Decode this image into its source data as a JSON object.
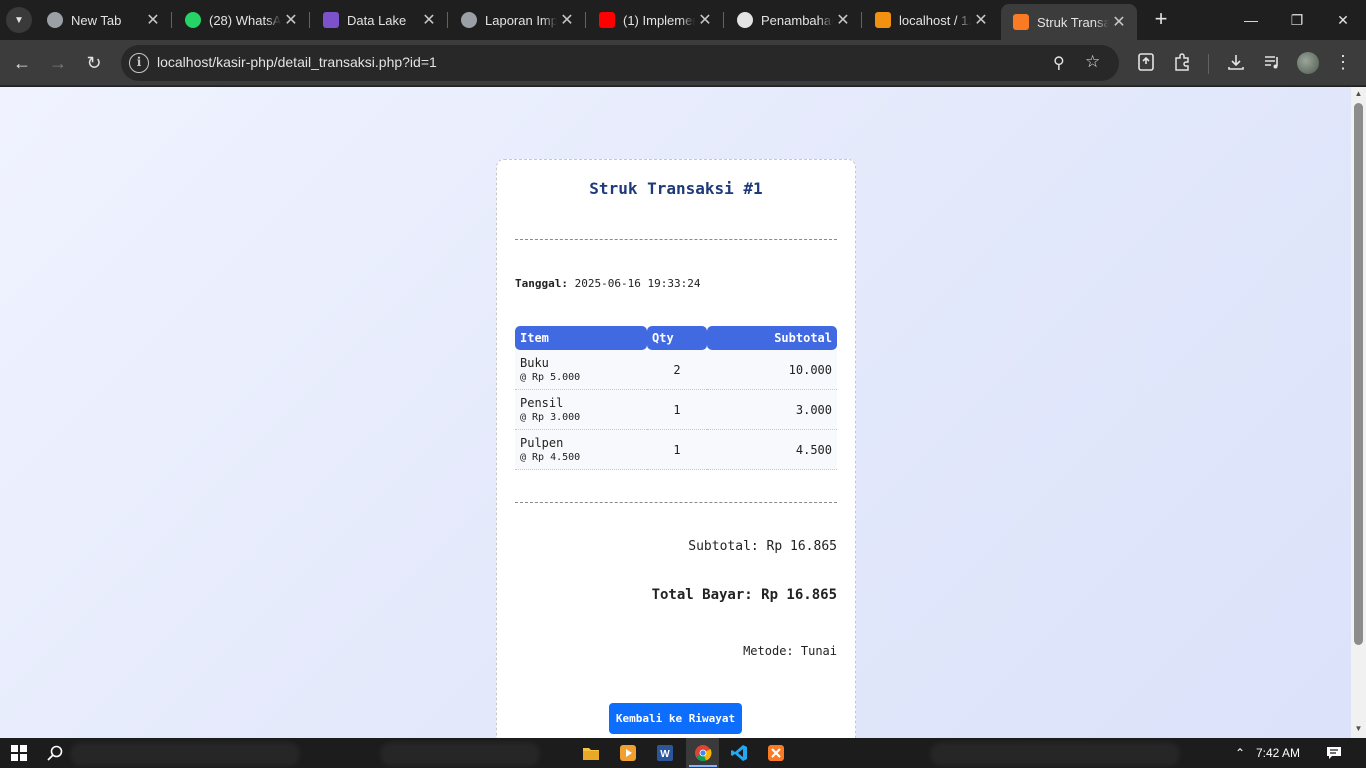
{
  "browser": {
    "tabs": [
      {
        "title": "New Tab",
        "icon": "chrome-icon",
        "color": "#9aa0a6"
      },
      {
        "title": "(28) WhatsApp",
        "icon": "whatsapp-icon",
        "color": "#25d366"
      },
      {
        "title": "Data Lake",
        "icon": "document-icon",
        "color": "#7b52c9"
      },
      {
        "title": "Laporan Implementasi",
        "icon": "globe-icon",
        "color": "#9aa0a6"
      },
      {
        "title": "(1) Implementasi",
        "icon": "youtube-icon",
        "color": "#ff0000"
      },
      {
        "title": "Penambahan",
        "icon": "openai-icon",
        "color": "#e3e3e3"
      },
      {
        "title": "localhost / 127.0.0.1",
        "icon": "phpmyadmin-icon",
        "color": "#f29111"
      },
      {
        "title": "Struk Transaksi",
        "icon": "xampp-icon",
        "color": "#fb7a24"
      }
    ],
    "active_tab_index": 7,
    "url": "localhost/kasir-php/detail_transaksi.php?id=1"
  },
  "receipt": {
    "title": "Struk Transaksi #1",
    "date_label": "Tanggal:",
    "date_value": "2025-06-16 19:33:24",
    "columns": {
      "item": "Item",
      "qty": "Qty",
      "subtotal": "Subtotal"
    },
    "items": [
      {
        "name": "Buku",
        "price": "@ Rp 5.000",
        "qty": "2",
        "subtotal": "10.000"
      },
      {
        "name": "Pensil",
        "price": "@ Rp 3.000",
        "qty": "1",
        "subtotal": "3.000"
      },
      {
        "name": "Pulpen",
        "price": "@ Rp 4.500",
        "qty": "1",
        "subtotal": "4.500"
      }
    ],
    "subtotal_text": "Subtotal: Rp 16.865",
    "total_text": "Total Bayar: Rp 16.865",
    "method_text": "Metode: Tunai",
    "back_button": "Kembali ke Riwayat"
  },
  "taskbar": {
    "clock": "7:42 AM"
  },
  "colors": {
    "accent": "#4169e1",
    "button": "#0d6efd",
    "title": "#1f3a7a"
  }
}
